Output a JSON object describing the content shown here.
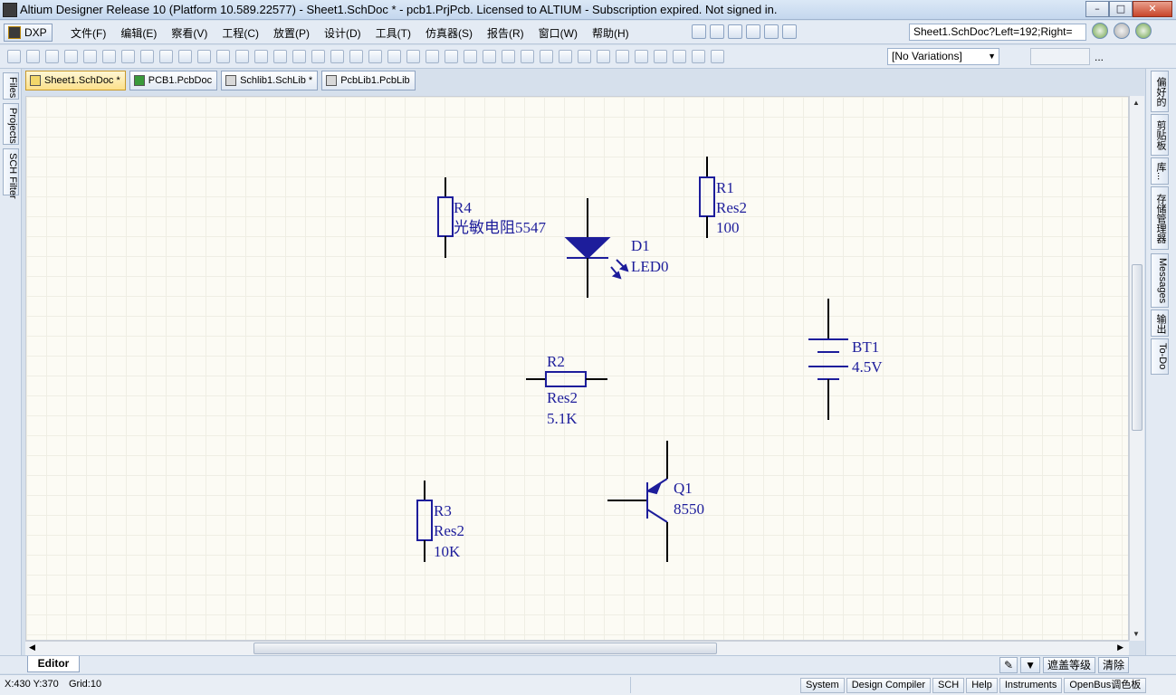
{
  "window": {
    "title": "Altium Designer Release 10 (Platform 10.589.22577) - Sheet1.SchDoc * - pcb1.PrjPcb. Licensed to ALTIUM - Subscription expired. Not signed in.",
    "controls": [
      "minimize-icon",
      "maximize-icon",
      "close-icon"
    ]
  },
  "menubar": {
    "dxp_label": "DXP",
    "items": [
      "文件(F)",
      "编辑(E)",
      "察看(V)",
      "工程(C)",
      "放置(P)",
      "设计(D)",
      "工具(T)",
      "仿真器(S)",
      "报告(R)",
      "窗口(W)",
      "帮助(H)"
    ],
    "address": "Sheet1.SchDoc?Left=192;Right="
  },
  "toolbar": {
    "variations": "[No Variations]",
    "overflow": "..."
  },
  "doc_tabs": [
    {
      "label": "Sheet1.SchDoc *",
      "type": "sch",
      "active": true
    },
    {
      "label": "PCB1.PcbDoc",
      "type": "pcb",
      "active": false
    },
    {
      "label": "Schlib1.SchLib *",
      "type": "lib",
      "active": false
    },
    {
      "label": "PcbLib1.PcbLib",
      "type": "pcblib",
      "active": false
    }
  ],
  "left_panels": [
    "Files",
    "Projects",
    "SCH Filter"
  ],
  "right_panels": [
    "偏好的",
    "剪贴板",
    "库...",
    "存储管理器",
    "Messages",
    "输出",
    "To-Do"
  ],
  "schematic": {
    "components": [
      {
        "designator": "R4",
        "comment": "光敏电阻5547",
        "kind": "resistor-vertical"
      },
      {
        "designator": "D1",
        "comment": "LED0",
        "kind": "led"
      },
      {
        "designator": "R1",
        "comment": "Res2",
        "value": "100",
        "kind": "resistor-vertical"
      },
      {
        "designator": "BT1",
        "comment": "4.5V",
        "kind": "battery"
      },
      {
        "designator": "R2",
        "comment": "Res2",
        "value": "5.1K",
        "kind": "resistor-horizontal"
      },
      {
        "designator": "R3",
        "comment": "Res2",
        "value": "10K",
        "kind": "resistor-vertical"
      },
      {
        "designator": "Q1",
        "comment": "8550",
        "kind": "pnp-transistor"
      }
    ],
    "color": "#1d1d9b"
  },
  "editor_tab": "Editor",
  "mask": {
    "level_label": "遮盖等级",
    "clear_label": "清除"
  },
  "status": {
    "coords": "X:430 Y:370",
    "grid": "Grid:10",
    "panel_buttons": [
      "System",
      "Design Compiler",
      "SCH",
      "Help",
      "Instruments",
      "OpenBus调色板"
    ]
  }
}
